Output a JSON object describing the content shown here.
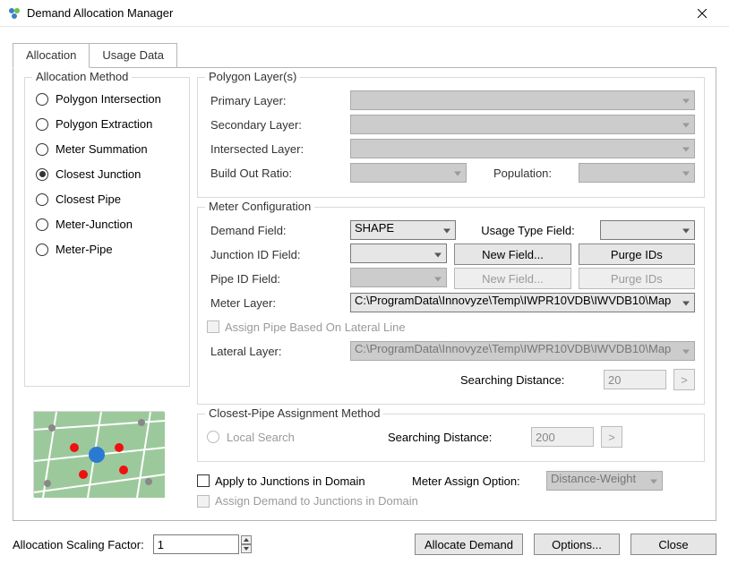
{
  "window": {
    "title": "Demand Allocation Manager"
  },
  "tabs": {
    "allocation": "Allocation",
    "usage": "Usage Data"
  },
  "allocMethod": {
    "legend": "Allocation Method",
    "options": [
      "Polygon Intersection",
      "Polygon Extraction",
      "Meter Summation",
      "Closest Junction",
      "Closest Pipe",
      "Meter-Junction",
      "Meter-Pipe"
    ],
    "selectedIndex": 3
  },
  "polygon": {
    "legend": "Polygon Layer(s)",
    "primary_lbl": "Primary Layer:",
    "secondary_lbl": "Secondary Layer:",
    "intersected_lbl": "Intersected Layer:",
    "buildout_lbl": "Build Out Ratio:",
    "population_lbl": "Population:"
  },
  "meter": {
    "legend": "Meter Configuration",
    "demand_lbl": "Demand Field:",
    "demand_val": "SHAPE",
    "usage_lbl": "Usage Type Field:",
    "junction_lbl": "Junction ID Field:",
    "pipe_lbl": "Pipe ID Field:",
    "newfield_btn": "New Field...",
    "purge_btn": "Purge IDs",
    "meter_layer_lbl": "Meter Layer:",
    "meter_layer_val": "C:\\ProgramData\\Innovyze\\Temp\\IWPR10VDB\\IWVDB10\\Map",
    "assign_lateral_lbl": "Assign Pipe Based On Lateral Line",
    "lateral_layer_lbl": "Lateral Layer:",
    "lateral_layer_val": "C:\\ProgramData\\Innovyze\\Temp\\IWPR10VDB\\IWVDB10\\Map",
    "searching_lbl": "Searching Distance:",
    "searching_val": "20",
    "gt_btn": ">"
  },
  "closestPipe": {
    "legend": "Closest-Pipe Assignment Method",
    "local_lbl": "Local Search",
    "searching_lbl": "Searching Distance:",
    "searching_val": "200",
    "gt_btn": ">"
  },
  "assign": {
    "apply_junctions": "Apply to Junctions in Domain",
    "meter_option_lbl": "Meter Assign Option:",
    "meter_option_val": "Distance-Weight",
    "assign_demand": "Assign Demand to Junctions in Domain"
  },
  "bottom": {
    "scaling_lbl": "Allocation Scaling Factor:",
    "scaling_val": "1",
    "allocate_btn": "Allocate Demand",
    "options_btn": "Options...",
    "close_btn": "Close"
  }
}
